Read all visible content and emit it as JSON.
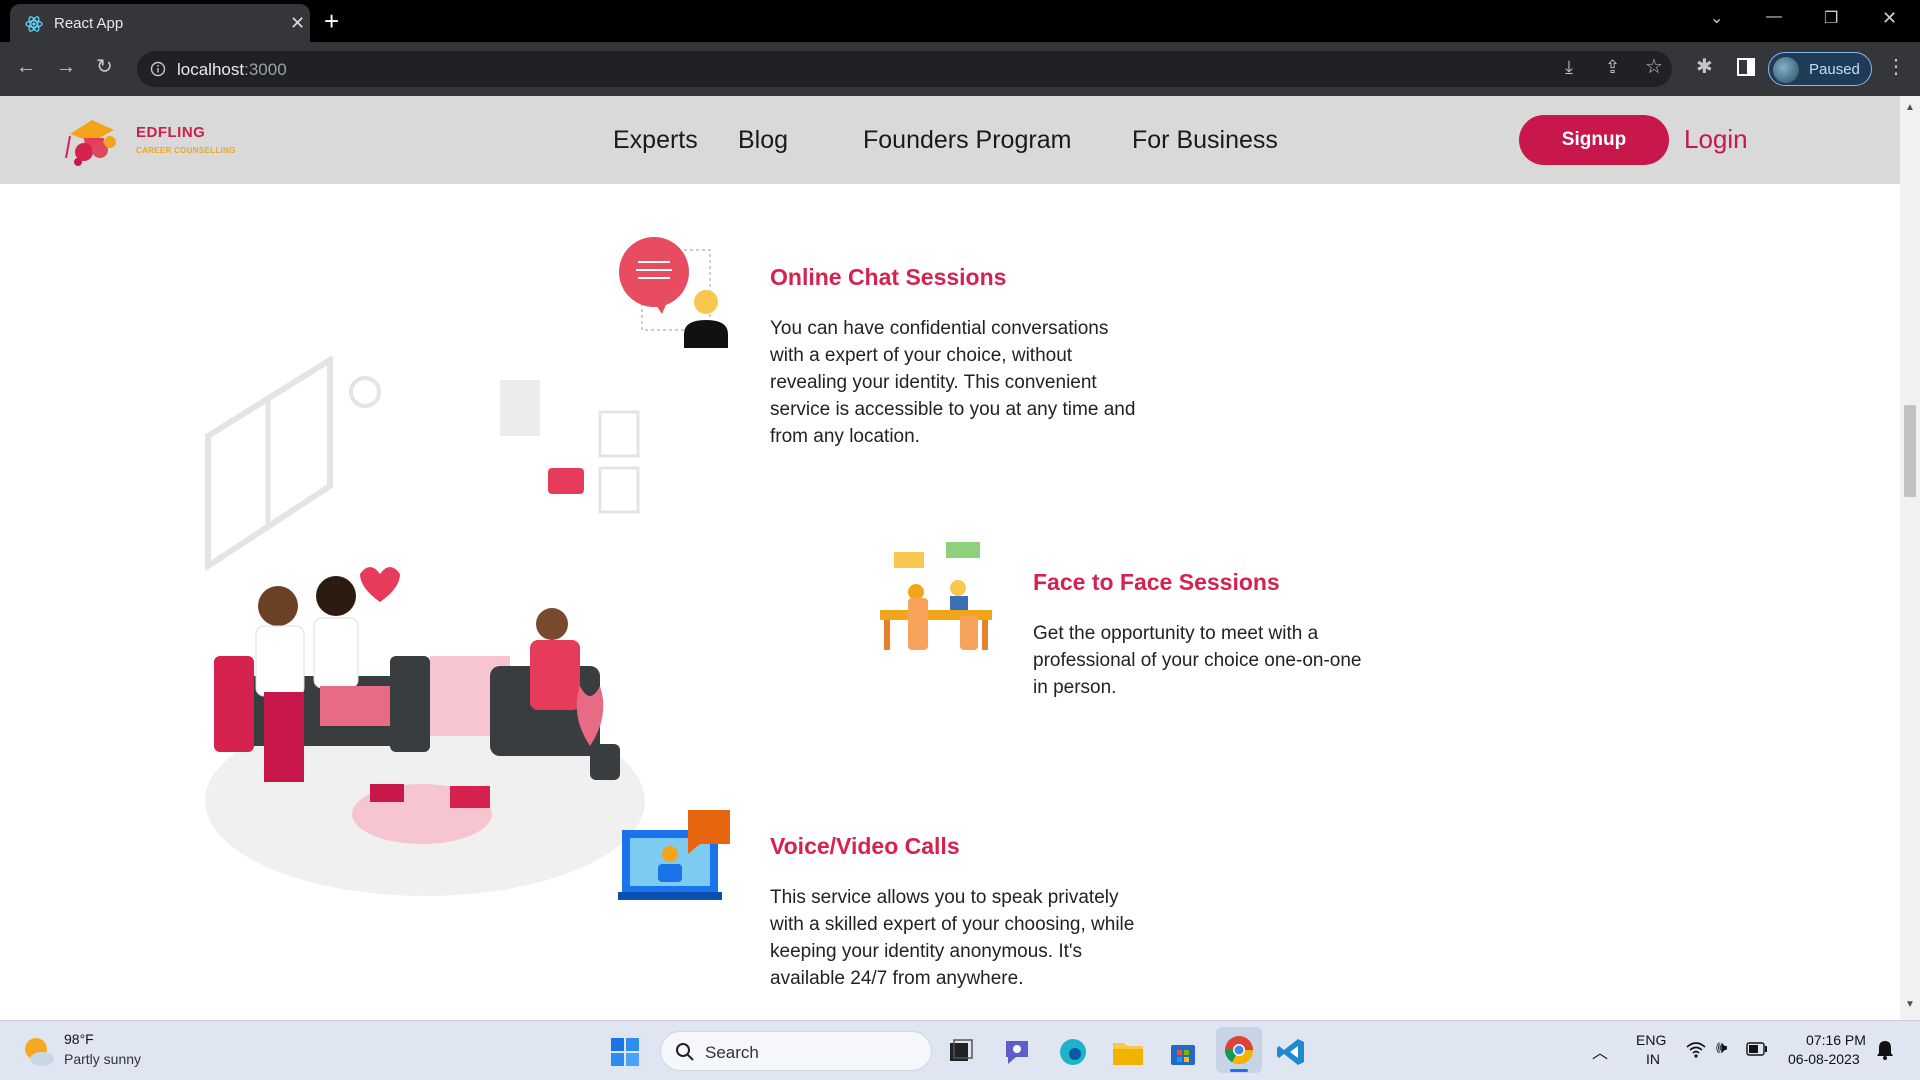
{
  "browser": {
    "tab_title": "React App",
    "tab_close": "✕",
    "new_tab": "+",
    "url_host": "localhost",
    "url_port": ":3000",
    "profile_status": "Paused"
  },
  "nav": {
    "logo_title": "EDFLING",
    "logo_subtitle": "CAREER COUNSELLING",
    "links": [
      "Experts",
      "Blog",
      "Founders Program",
      "For Business"
    ],
    "signup_label": "Signup",
    "login_label": "Login"
  },
  "services": [
    {
      "title": "Online Chat Sessions",
      "description": "You can have confidential conversations with a expert of your choice, without revealing your identity. This convenient service is accessible to you at any time and from any location."
    },
    {
      "title": "Face to Face Sessions",
      "description": "Get the opportunity to meet with a professional of your choice one-on-one in person."
    },
    {
      "title": "Voice/Video Calls",
      "description": "This service allows you to speak privately with a skilled expert of your choosing, while keeping your identity anonymous. It's available 24/7 from anywhere."
    }
  ],
  "taskbar": {
    "weather_temp": "98°F",
    "weather_desc": "Partly sunny",
    "search_label": "Search",
    "lang_line1": "ENG",
    "lang_line2": "IN",
    "time": "07:16 PM",
    "date": "06-08-2023"
  },
  "colors": {
    "brand": "#c8174a",
    "title": "#d6224f",
    "nav_bg": "#d9d9d9"
  }
}
